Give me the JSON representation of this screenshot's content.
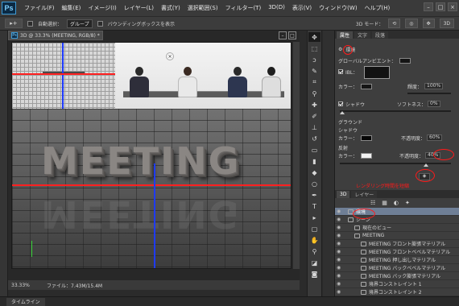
{
  "app": {
    "logo": "Ps"
  },
  "menu": [
    "ファイル(F)",
    "編集(E)",
    "イメージ(I)",
    "レイヤー(L)",
    "書式(Y)",
    "選択範囲(S)",
    "フィルター(T)",
    "3D(D)",
    "表示(V)",
    "ウィンドウ(W)",
    "ヘルプ(H)"
  ],
  "window_controls": [
    "–",
    "□",
    "×"
  ],
  "options": {
    "auto_select_label": "自動選択：",
    "auto_select_value": "グループ",
    "bbox_label": "バウンディングボックスを表示",
    "mode_label": "3D モード：",
    "workspace": "3D"
  },
  "document": {
    "tab_title": "3D @ 33.3% (MEETING, RGB/8) *",
    "title_text": "MEETING",
    "zoom": "33.33%",
    "file_info": "ファイル：7.43M/15.4M"
  },
  "properties": {
    "tabs": [
      "属性",
      "文字",
      "段落"
    ],
    "header": "環境",
    "global_ambient_label": "グローバルアンビエント：",
    "ibl_label": "IBL：",
    "color_label": "カラー：",
    "brightness_label": "輝度：",
    "brightness_value": "100%",
    "shadow_label": "シャドウ",
    "softness_label": "ソフトネス：",
    "softness_value": "0%",
    "ground_label": "グラウンド",
    "shadow_sub_label": "シャドウ",
    "shadow_color_label": "カラー：",
    "opacity_label": "不透明度：",
    "shadow_opacity_value": "60%",
    "reflect_label": "反射",
    "reflect_color_label": "カラー：",
    "reflect_opacity_label": "不透明度：",
    "reflect_opacity_value": "40%",
    "annotation_text": "レンダリング時間を短縮"
  },
  "layers_panel": {
    "tabs": [
      "3D",
      "レイヤー"
    ],
    "rows": [
      {
        "label": "環境",
        "selected": true,
        "indent": 0
      },
      {
        "label": "シーン",
        "selected": false,
        "indent": 0
      },
      {
        "label": "現在のビュー",
        "selected": false,
        "indent": 1
      },
      {
        "label": "MEETING",
        "selected": false,
        "indent": 1
      },
      {
        "label": "MEETING フロント膨張マテリアル",
        "selected": false,
        "indent": 2
      },
      {
        "label": "MEETING フロントベベルマテリアル",
        "selected": false,
        "indent": 2
      },
      {
        "label": "MEETING 押し出しマテリアル",
        "selected": false,
        "indent": 2
      },
      {
        "label": "MEETING バックベベルマテリアル",
        "selected": false,
        "indent": 2
      },
      {
        "label": "MEETING バック膨張マテリアル",
        "selected": false,
        "indent": 2
      },
      {
        "label": "境界コンストレイント 1",
        "selected": false,
        "indent": 2
      },
      {
        "label": "境界コンストレイント 2",
        "selected": false,
        "indent": 2
      }
    ]
  },
  "timeline": {
    "label": "タイムライン"
  },
  "colors": {
    "highlight": "#ff1a1a",
    "axis_x": "#ff2020",
    "axis_y": "#1e3aff",
    "axis_z": "#35d435",
    "selected_row": "#6f7f96"
  }
}
